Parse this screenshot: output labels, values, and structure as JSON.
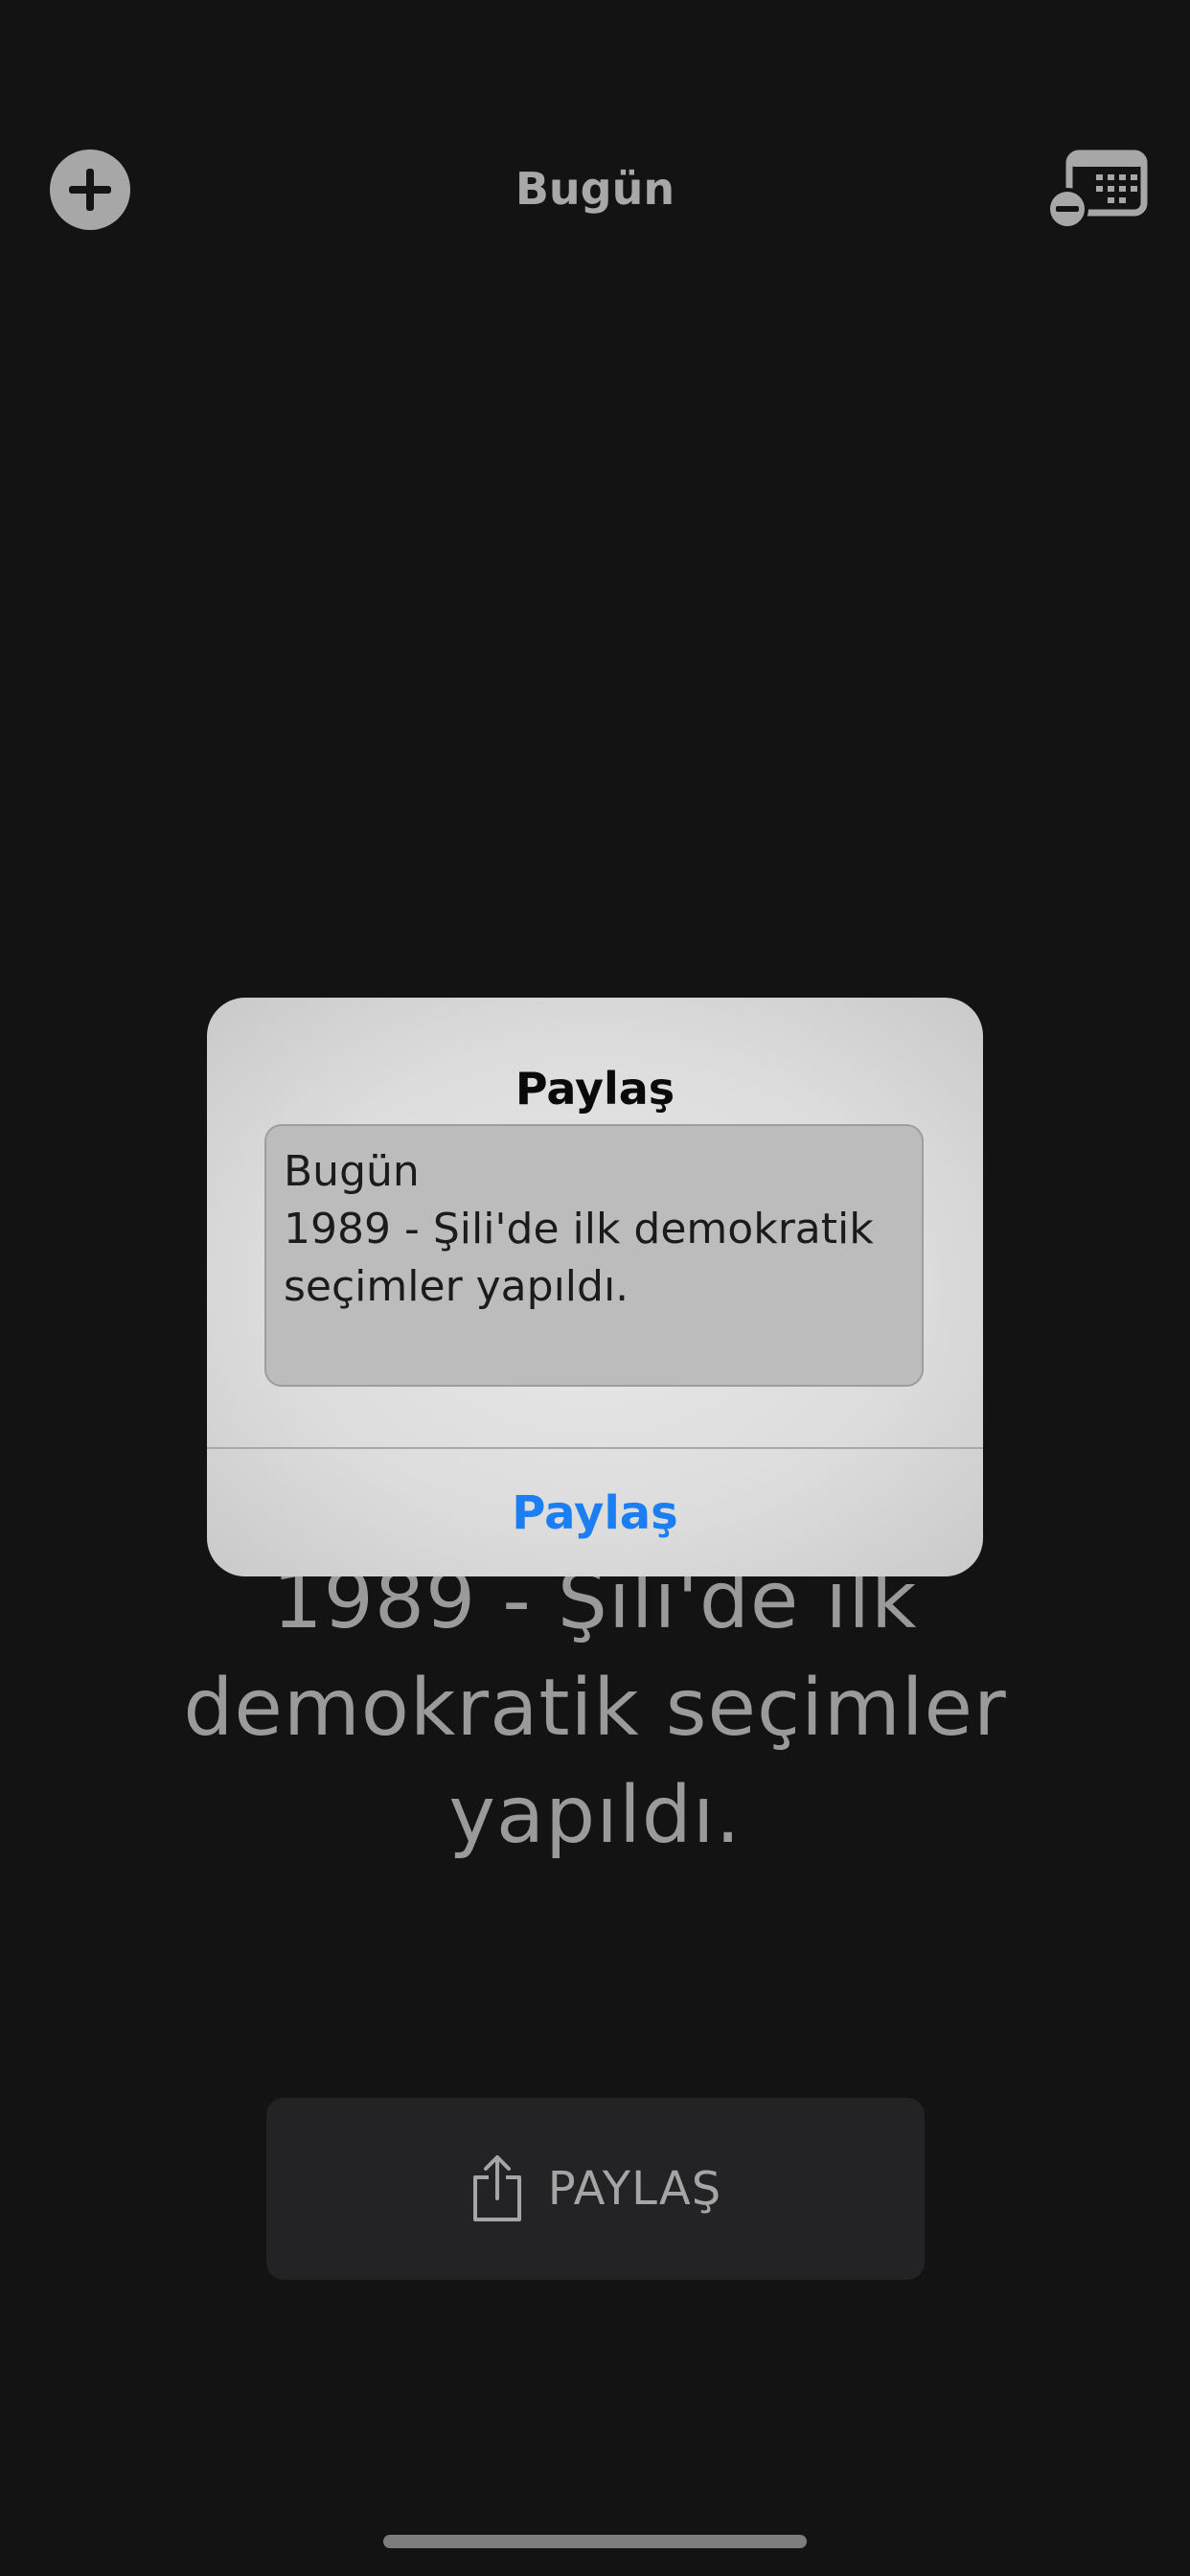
{
  "nav": {
    "title": "Bugün",
    "add_icon": "plus-icon",
    "calendar_icon": "calendar-remove-icon"
  },
  "main": {
    "fact_text": "1989 - Şili'de ilk demokratik seçimler yapıldı.",
    "share_button_label": "PAYLAŞ",
    "share_icon": "share-icon"
  },
  "alert": {
    "title": "Paylaş",
    "text_value": "Bugün\n1989 - Şili'de ilk demokratik seçimler yapıldı.",
    "action_label": "Paylaş"
  },
  "colors": {
    "background": "#131313",
    "accent_blue": "#1b7ef2"
  }
}
